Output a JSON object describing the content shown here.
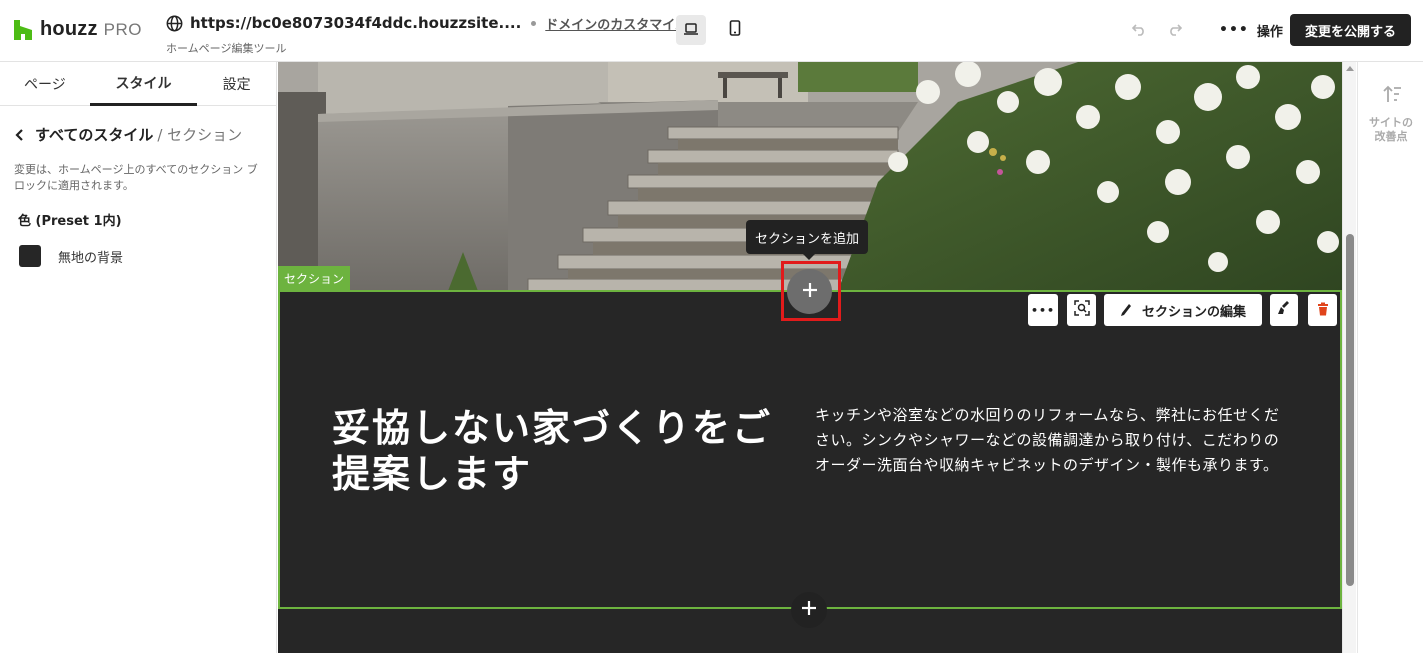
{
  "brand": {
    "name": "houzz",
    "suffix": "PRO"
  },
  "site": {
    "url": "https://bc0e8073034f4ddc.houzzsite....",
    "customize_domain": "ドメインのカスタマイズ",
    "subtitle": "ホームページ編集ツール"
  },
  "toolbar": {
    "operations": "操作",
    "publish": "変更を公開する"
  },
  "left_panel": {
    "tabs": [
      {
        "label": "ページ",
        "active": false
      },
      {
        "label": "スタイル",
        "active": true
      },
      {
        "label": "設定",
        "active": false
      }
    ],
    "breadcrumb": {
      "parent": "すべてのスタイル",
      "current": "/ セクション"
    },
    "description": "変更は、ホームページ上のすべてのセクション ブロックに適用されます。",
    "color_heading": "色 (Preset 1内)",
    "color_option": {
      "label": "無地の背景",
      "swatch": "#262626"
    }
  },
  "canvas": {
    "section_label": "セクション",
    "tooltip": "セクションを追加",
    "edit_section": "セクションの編集",
    "headline": "妥協しない家づくりをご提案します",
    "body": "キッチンや浴室などの水回りのリフォームなら、弊社にお任せください。シンクやシャワーなどの設備調達から取り付け、こだわりのオーダー洗面台や収納キャビネットのデザイン・製作も承ります。"
  },
  "right_panel": {
    "improve_label": "サイトの\n改善点"
  },
  "colors": {
    "accent_green": "#6db33f",
    "highlight_red": "#e11b1b",
    "dark": "#262626"
  }
}
